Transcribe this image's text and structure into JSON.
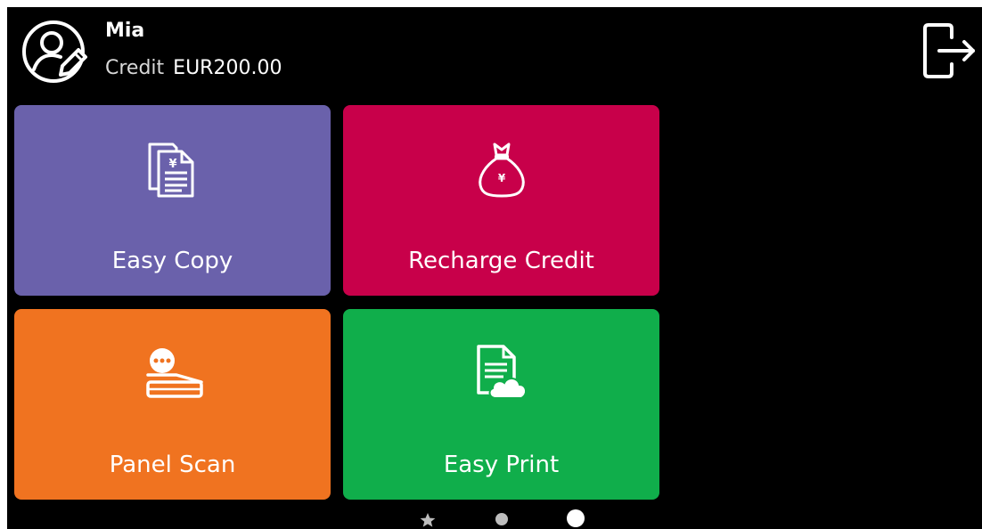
{
  "user": {
    "name": "Mia",
    "credit_label": "Credit",
    "credit_value": "EUR200.00",
    "avatar_icon": "user-edit-icon"
  },
  "header": {
    "logout_icon": "logout-icon"
  },
  "tiles": [
    {
      "label": "Easy Copy",
      "icon": "copy-documents-icon",
      "color": "#6a61ab"
    },
    {
      "label": "Recharge Credit",
      "icon": "money-bag-icon",
      "color": "#c8004a"
    },
    {
      "label": "Panel Scan",
      "icon": "scanner-icon",
      "color": "#f07320"
    },
    {
      "label": "Easy Print",
      "icon": "cloud-print-document-icon",
      "color": "#10ae4b"
    }
  ],
  "pager": {
    "items": [
      "favorites-star-icon",
      "page-dot",
      "page-dot-active"
    ],
    "active_index": 2
  }
}
